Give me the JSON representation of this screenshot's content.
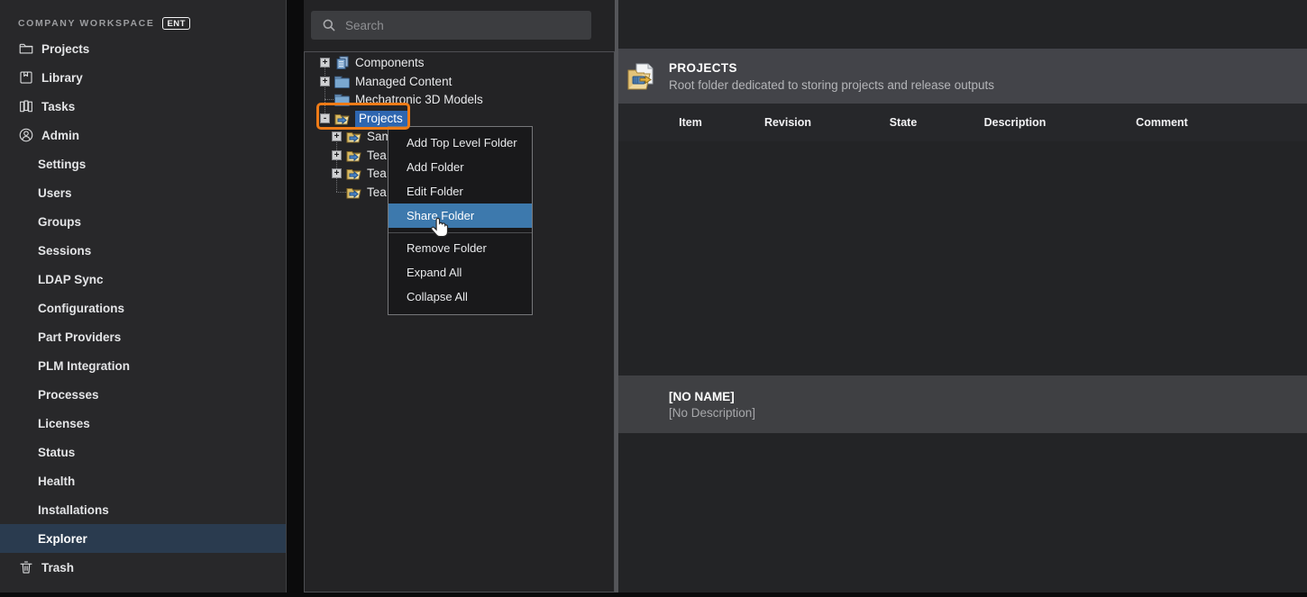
{
  "sidebar": {
    "workspace_label": "COMPANY WORKSPACE",
    "workspace_badge": "ENT",
    "items": [
      "Projects",
      "Library",
      "Tasks",
      "Admin"
    ],
    "admin_subitems": [
      "Settings",
      "Users",
      "Groups",
      "Sessions",
      "LDAP Sync",
      "Configurations",
      "Part Providers",
      "PLM Integration",
      "Processes",
      "Licenses",
      "Status",
      "Health",
      "Installations",
      "Explorer"
    ],
    "selected_item": "Explorer",
    "trash_label": "Trash"
  },
  "search": {
    "placeholder": "Search"
  },
  "tree_panel": {
    "nodes": [
      {
        "label": "Components",
        "expander": "+"
      },
      {
        "label": "Managed Content",
        "expander": "+"
      },
      {
        "label": "Mechatronic 3D Models",
        "expander": ""
      },
      {
        "label": "Projects",
        "expander": "-",
        "selected": true,
        "annotated": true
      },
      {
        "label": "Sam",
        "expander": "+"
      },
      {
        "label": "Tea",
        "expander": "+"
      },
      {
        "label": "Tea",
        "expander": "+"
      },
      {
        "label": "Tea",
        "expander": ""
      }
    ]
  },
  "context_menu": {
    "items_top": [
      "Add Top Level Folder",
      "Add Folder",
      "Edit Folder",
      "Share Folder"
    ],
    "items_bottom": [
      "Remove Folder",
      "Expand All",
      "Collapse All"
    ],
    "highlighted_item": "Share Folder"
  },
  "detail_panel": {
    "title": "PROJECTS",
    "subtitle": "Root folder dedicated to storing projects and release outputs",
    "columns": [
      "Item",
      "Revision",
      "State",
      "Description",
      "Comment"
    ],
    "empty_selection": {
      "name": "[NO NAME]",
      "description": "[No Description]"
    }
  },
  "icons": {
    "sidebar": [
      "folder-icon",
      "library-icon",
      "tasks-icon",
      "admin-icon",
      "trash-icon"
    ],
    "search": "search-icon",
    "tree": [
      "components-icon",
      "folder-closed-icon",
      "folder-open-shared-icon"
    ],
    "detail_header": "projects-folder-icon",
    "cursor": "hand-pointer-cursor"
  },
  "colors": {
    "annotation_orange": "#EE7B17",
    "tree_selection_blue": "#2E66B0",
    "menu_highlight_blue": "#3D79AD",
    "sidebar_selected_bg": "#2A3B4F",
    "header_bar_gray": "#434449",
    "panel_background": "#232325",
    "sidebar_background": "#28282A"
  }
}
